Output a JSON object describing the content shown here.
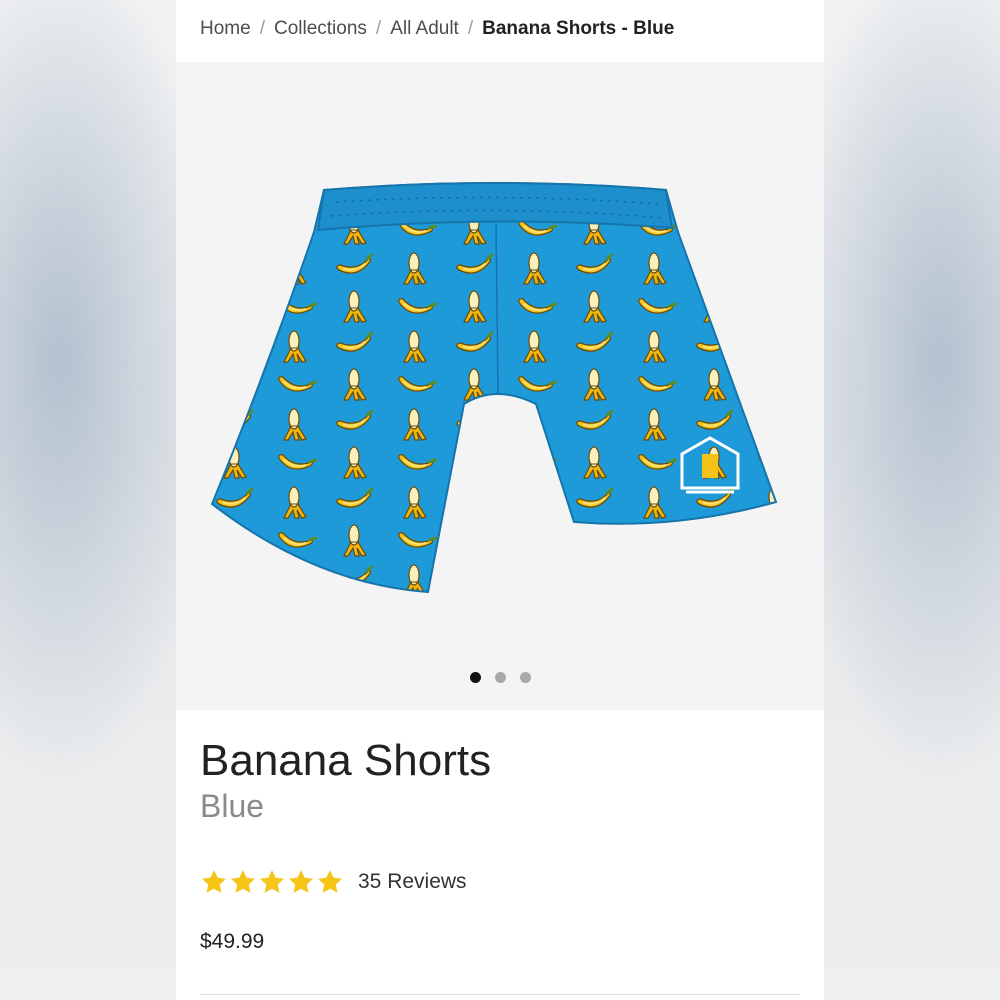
{
  "breadcrumb": {
    "items": [
      "Home",
      "Collections",
      "All Adult"
    ],
    "separator": "/",
    "current": "Banana Shorts - Blue"
  },
  "gallery": {
    "image_icon": "banana-shorts-product-photo",
    "slide_count": 3,
    "active_slide": 1
  },
  "product": {
    "title": "Banana Shorts",
    "variant": "Blue",
    "rating": 5,
    "rating_max": 5,
    "reviews_label": "35 Reviews",
    "price": "$49.99"
  },
  "colors": {
    "shorts_blue": "#1f9ad9",
    "banana_yellow": "#f4c316",
    "star_yellow": "#f5c518",
    "dot_active": "#111111",
    "dot_inactive": "#a8a8a8"
  }
}
